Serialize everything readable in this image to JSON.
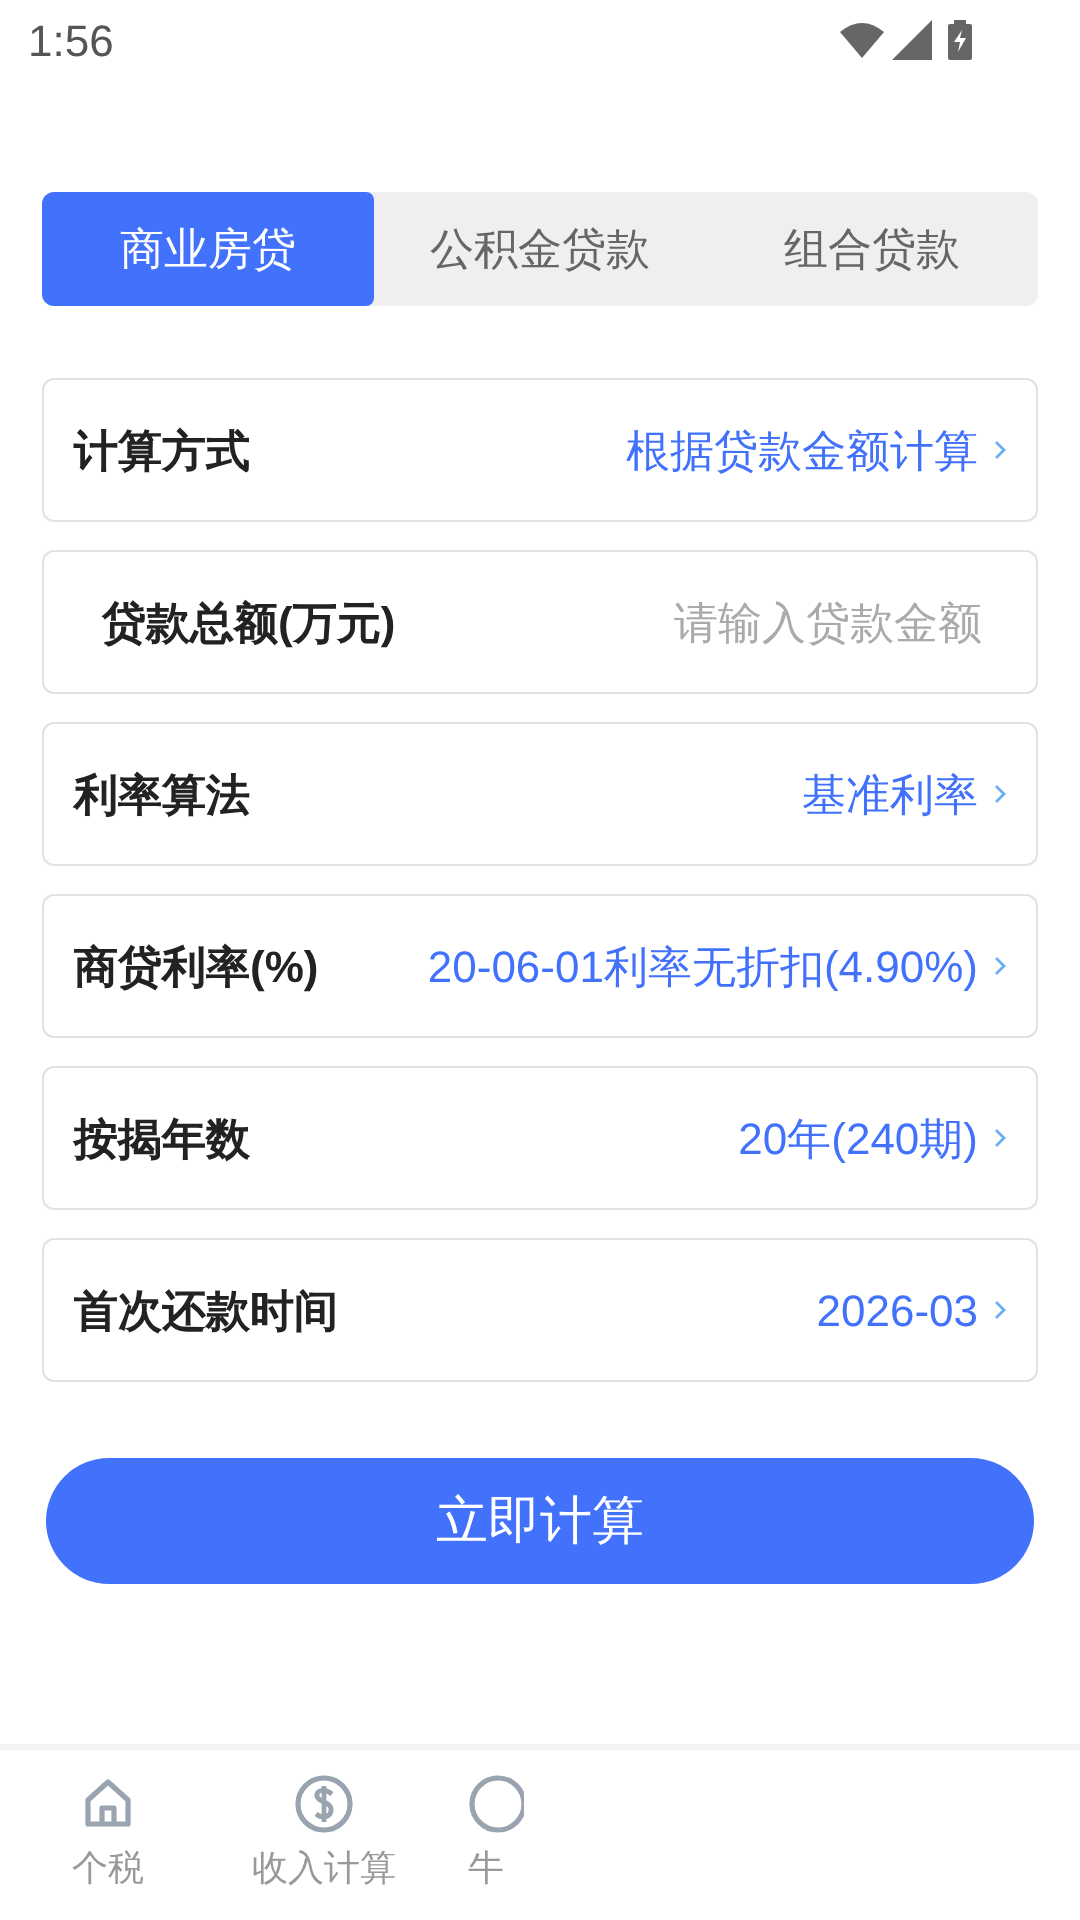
{
  "status_bar": {
    "time": "1:56"
  },
  "tabs": [
    {
      "label": "商业房贷",
      "selected": true
    },
    {
      "label": "公积金贷款",
      "selected": false
    },
    {
      "label": "组合贷款",
      "selected": false
    }
  ],
  "form_rows": [
    {
      "kind": "select",
      "label": "计算方式",
      "value": "根据贷款金额计算"
    },
    {
      "kind": "input",
      "label": "贷款总额(万元)",
      "placeholder": "请输入贷款金额"
    },
    {
      "kind": "select",
      "label": "利率算法",
      "value": "基准利率"
    },
    {
      "kind": "select",
      "label": "商贷利率(%)",
      "value": "20-06-01利率无折扣(4.90%)"
    },
    {
      "kind": "select",
      "label": "按揭年数",
      "value": "20年(240期)"
    },
    {
      "kind": "select",
      "label": "首次还款时间",
      "value": "2026-03"
    }
  ],
  "calculate_button": "立即计算",
  "bottom_nav": [
    {
      "label": "个税"
    },
    {
      "label": "收入计算"
    },
    {
      "label": "牛"
    }
  ]
}
